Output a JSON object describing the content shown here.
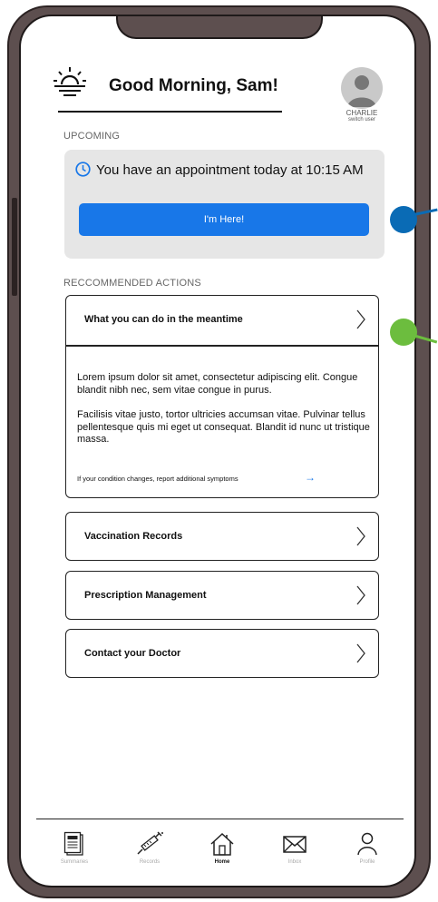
{
  "header": {
    "greeting": "Good Morning, Sam!",
    "user_name": "CHARLIE",
    "switch_user": "switch user"
  },
  "upcoming": {
    "label": "UPCOMING",
    "appointment_text": "You have an appointment today at 10:15 AM",
    "button_label": "I'm Here!"
  },
  "recommended": {
    "label": "RECCOMMENDED ACTIONS",
    "expanded_card": {
      "title": "What you can do in the meantime",
      "paragraph1": "Lorem ipsum dolor sit amet, consectetur adipiscing elit. Congue blandit nibh nec, sem vitae congue in purus.",
      "paragraph2": "Facilisis vitae justo, tortor ultricies accumsan vitae. Pulvinar tellus pellentesque quis mi eget ut consequat. Blandit id nunc ut tristique massa.",
      "link_text": "If your condition changes, report additional symptoms",
      "link_arrow": "→"
    },
    "cards": [
      {
        "title": "Vaccination Records"
      },
      {
        "title": "Prescription Management"
      },
      {
        "title": "Contact your Doctor"
      }
    ]
  },
  "nav": {
    "items": [
      {
        "label": "Summaries",
        "icon": "document-icon",
        "active": false
      },
      {
        "label": "Records",
        "icon": "syringe-icon",
        "active": false
      },
      {
        "label": "Home",
        "icon": "home-icon",
        "active": true
      },
      {
        "label": "Inbox",
        "icon": "mail-icon",
        "active": false
      },
      {
        "label": "Profile",
        "icon": "person-icon",
        "active": false
      }
    ]
  },
  "colors": {
    "primary_button": "#1877e8",
    "annotation_blue": "#0a6bb5",
    "annotation_green": "#6cbd3e",
    "device_frame": "#5d4f4f"
  }
}
